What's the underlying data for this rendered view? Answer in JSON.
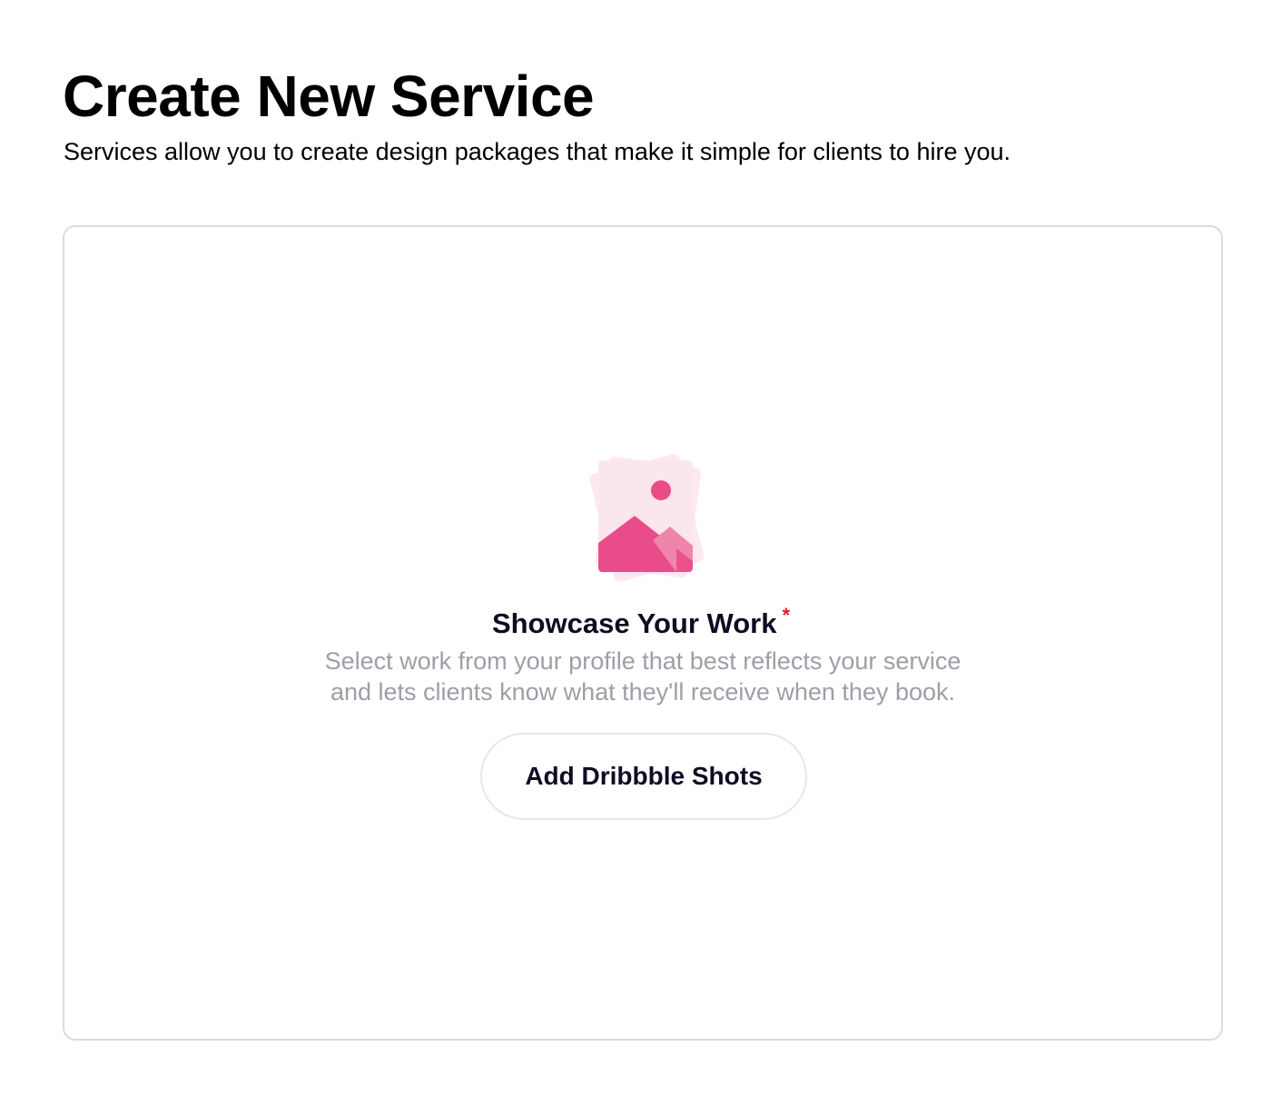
{
  "header": {
    "title": "Create New Service",
    "subtitle": "Services allow you to create design packages that make it simple for clients to hire you."
  },
  "showcase": {
    "icon": "image-stack-icon",
    "title": "Showcase Your Work",
    "required_mark": "*",
    "description_line1": "Select work from your profile that best reflects your service",
    "description_line2": "and lets clients know what they'll receive when they book.",
    "button_label": "Add Dribbble Shots"
  },
  "colors": {
    "accent_pink": "#ea4c89",
    "light_pink": "#fde4ee",
    "required_red": "#ea1a22",
    "muted_text": "#9e9ea7",
    "border": "#dcdcde"
  }
}
